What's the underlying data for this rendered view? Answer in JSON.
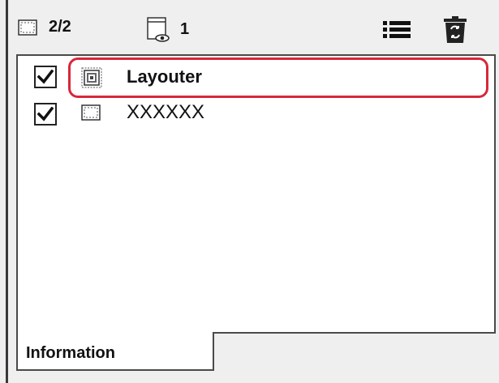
{
  "toolbar": {
    "layer_count_icon": "frame-icon",
    "layer_count": "2/2",
    "view_icon": "layer-view-icon",
    "view_count": "1",
    "list_icon": "list-icon",
    "trash_icon": "trash-icon"
  },
  "layers": [
    {
      "label": "Layouter",
      "icon": "layouter-icon",
      "checked": true,
      "highlighted": true
    },
    {
      "label": "XXXXXX",
      "icon": "frame-icon",
      "checked": true,
      "highlighted": false
    }
  ],
  "tabs": [
    {
      "label": "Information"
    }
  ],
  "colors": {
    "highlight": "#d9273a",
    "trash_badge": "#222222"
  }
}
